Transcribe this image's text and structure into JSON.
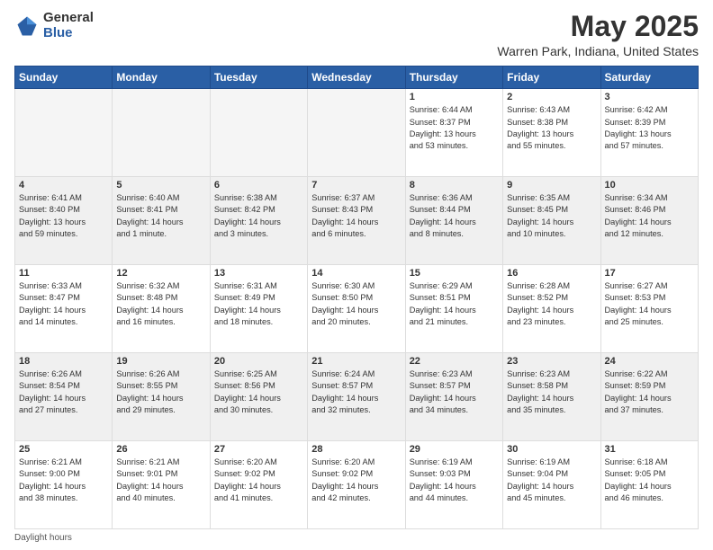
{
  "logo": {
    "general": "General",
    "blue": "Blue"
  },
  "title": "May 2025",
  "subtitle": "Warren Park, Indiana, United States",
  "days_of_week": [
    "Sunday",
    "Monday",
    "Tuesday",
    "Wednesday",
    "Thursday",
    "Friday",
    "Saturday"
  ],
  "footer": {
    "daylight_label": "Daylight hours"
  },
  "weeks": [
    [
      {
        "day": "",
        "info": "",
        "empty": true
      },
      {
        "day": "",
        "info": "",
        "empty": true
      },
      {
        "day": "",
        "info": "",
        "empty": true
      },
      {
        "day": "",
        "info": "",
        "empty": true
      },
      {
        "day": "1",
        "info": "Sunrise: 6:44 AM\nSunset: 8:37 PM\nDaylight: 13 hours\nand 53 minutes.",
        "empty": false
      },
      {
        "day": "2",
        "info": "Sunrise: 6:43 AM\nSunset: 8:38 PM\nDaylight: 13 hours\nand 55 minutes.",
        "empty": false
      },
      {
        "day": "3",
        "info": "Sunrise: 6:42 AM\nSunset: 8:39 PM\nDaylight: 13 hours\nand 57 minutes.",
        "empty": false
      }
    ],
    [
      {
        "day": "4",
        "info": "Sunrise: 6:41 AM\nSunset: 8:40 PM\nDaylight: 13 hours\nand 59 minutes.",
        "empty": false
      },
      {
        "day": "5",
        "info": "Sunrise: 6:40 AM\nSunset: 8:41 PM\nDaylight: 14 hours\nand 1 minute.",
        "empty": false
      },
      {
        "day": "6",
        "info": "Sunrise: 6:38 AM\nSunset: 8:42 PM\nDaylight: 14 hours\nand 3 minutes.",
        "empty": false
      },
      {
        "day": "7",
        "info": "Sunrise: 6:37 AM\nSunset: 8:43 PM\nDaylight: 14 hours\nand 6 minutes.",
        "empty": false
      },
      {
        "day": "8",
        "info": "Sunrise: 6:36 AM\nSunset: 8:44 PM\nDaylight: 14 hours\nand 8 minutes.",
        "empty": false
      },
      {
        "day": "9",
        "info": "Sunrise: 6:35 AM\nSunset: 8:45 PM\nDaylight: 14 hours\nand 10 minutes.",
        "empty": false
      },
      {
        "day": "10",
        "info": "Sunrise: 6:34 AM\nSunset: 8:46 PM\nDaylight: 14 hours\nand 12 minutes.",
        "empty": false
      }
    ],
    [
      {
        "day": "11",
        "info": "Sunrise: 6:33 AM\nSunset: 8:47 PM\nDaylight: 14 hours\nand 14 minutes.",
        "empty": false
      },
      {
        "day": "12",
        "info": "Sunrise: 6:32 AM\nSunset: 8:48 PM\nDaylight: 14 hours\nand 16 minutes.",
        "empty": false
      },
      {
        "day": "13",
        "info": "Sunrise: 6:31 AM\nSunset: 8:49 PM\nDaylight: 14 hours\nand 18 minutes.",
        "empty": false
      },
      {
        "day": "14",
        "info": "Sunrise: 6:30 AM\nSunset: 8:50 PM\nDaylight: 14 hours\nand 20 minutes.",
        "empty": false
      },
      {
        "day": "15",
        "info": "Sunrise: 6:29 AM\nSunset: 8:51 PM\nDaylight: 14 hours\nand 21 minutes.",
        "empty": false
      },
      {
        "day": "16",
        "info": "Sunrise: 6:28 AM\nSunset: 8:52 PM\nDaylight: 14 hours\nand 23 minutes.",
        "empty": false
      },
      {
        "day": "17",
        "info": "Sunrise: 6:27 AM\nSunset: 8:53 PM\nDaylight: 14 hours\nand 25 minutes.",
        "empty": false
      }
    ],
    [
      {
        "day": "18",
        "info": "Sunrise: 6:26 AM\nSunset: 8:54 PM\nDaylight: 14 hours\nand 27 minutes.",
        "empty": false
      },
      {
        "day": "19",
        "info": "Sunrise: 6:26 AM\nSunset: 8:55 PM\nDaylight: 14 hours\nand 29 minutes.",
        "empty": false
      },
      {
        "day": "20",
        "info": "Sunrise: 6:25 AM\nSunset: 8:56 PM\nDaylight: 14 hours\nand 30 minutes.",
        "empty": false
      },
      {
        "day": "21",
        "info": "Sunrise: 6:24 AM\nSunset: 8:57 PM\nDaylight: 14 hours\nand 32 minutes.",
        "empty": false
      },
      {
        "day": "22",
        "info": "Sunrise: 6:23 AM\nSunset: 8:57 PM\nDaylight: 14 hours\nand 34 minutes.",
        "empty": false
      },
      {
        "day": "23",
        "info": "Sunrise: 6:23 AM\nSunset: 8:58 PM\nDaylight: 14 hours\nand 35 minutes.",
        "empty": false
      },
      {
        "day": "24",
        "info": "Sunrise: 6:22 AM\nSunset: 8:59 PM\nDaylight: 14 hours\nand 37 minutes.",
        "empty": false
      }
    ],
    [
      {
        "day": "25",
        "info": "Sunrise: 6:21 AM\nSunset: 9:00 PM\nDaylight: 14 hours\nand 38 minutes.",
        "empty": false
      },
      {
        "day": "26",
        "info": "Sunrise: 6:21 AM\nSunset: 9:01 PM\nDaylight: 14 hours\nand 40 minutes.",
        "empty": false
      },
      {
        "day": "27",
        "info": "Sunrise: 6:20 AM\nSunset: 9:02 PM\nDaylight: 14 hours\nand 41 minutes.",
        "empty": false
      },
      {
        "day": "28",
        "info": "Sunrise: 6:20 AM\nSunset: 9:02 PM\nDaylight: 14 hours\nand 42 minutes.",
        "empty": false
      },
      {
        "day": "29",
        "info": "Sunrise: 6:19 AM\nSunset: 9:03 PM\nDaylight: 14 hours\nand 44 minutes.",
        "empty": false
      },
      {
        "day": "30",
        "info": "Sunrise: 6:19 AM\nSunset: 9:04 PM\nDaylight: 14 hours\nand 45 minutes.",
        "empty": false
      },
      {
        "day": "31",
        "info": "Sunrise: 6:18 AM\nSunset: 9:05 PM\nDaylight: 14 hours\nand 46 minutes.",
        "empty": false
      }
    ]
  ]
}
